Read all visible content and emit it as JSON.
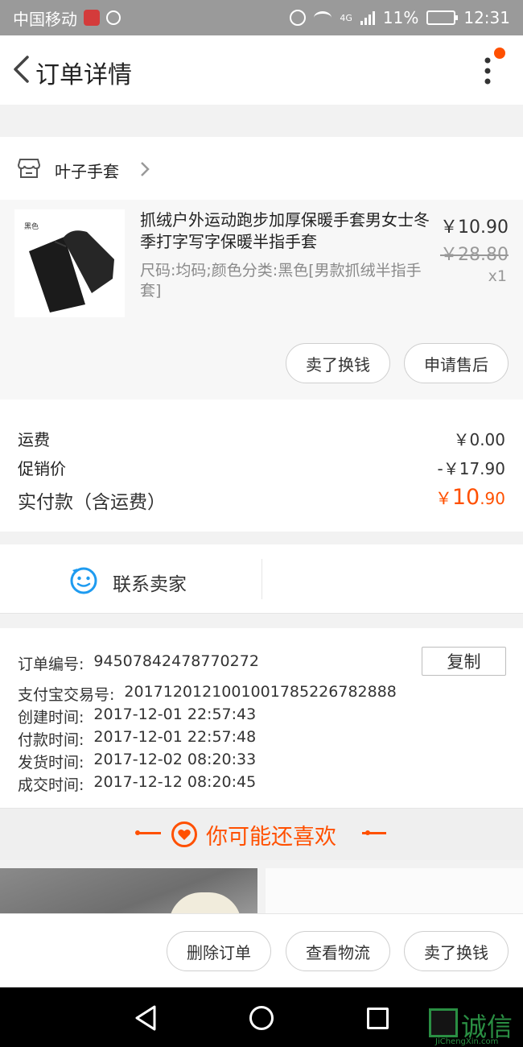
{
  "status_bar": {
    "carrier": "中国移动",
    "network": "4G",
    "battery": "11%",
    "time": "12:31",
    "icons": [
      "notification-badge-icon",
      "hand-icon",
      "alarm-icon",
      "wifi-icon",
      "signal-icon",
      "battery-icon"
    ]
  },
  "nav": {
    "title": "订单详情",
    "back_icon": "chevron-left-icon",
    "more_icon": "more-vertical-icon",
    "accent": "#ff5000"
  },
  "shop": {
    "name": "叶子手套",
    "icon": "store-icon"
  },
  "item": {
    "thumb_tag": "黑色",
    "title": "抓绒户外运动跑步加厚保暖手套男女士冬季打字写字保暖半指手套",
    "spec": "尺码:均码;颜色分类:黑色[男款抓绒半指手套]",
    "price": "￥10.90",
    "original_price": "￥28.80",
    "quantity": "x1",
    "buttons": [
      "卖了换钱",
      "申请售后"
    ]
  },
  "summary": {
    "shipping_label": "运费",
    "shipping_value": "￥0.00",
    "promo_label": "促销价",
    "promo_value": "-￥17.90",
    "paid_label": "实付款（含运费）",
    "paid_currency": "￥",
    "paid_integer": "10",
    "paid_decimal": ".90"
  },
  "contact": {
    "label": "联系卖家",
    "icon": "smile-chat-icon"
  },
  "order_info": {
    "copy_label": "复制",
    "rows": [
      {
        "label": "订单编号:",
        "value": "94507842478770272"
      },
      {
        "label": "支付宝交易号:",
        "value": "2017120121001001785226782888"
      },
      {
        "label": "创建时间:",
        "value": "2017-12-01 22:57:43"
      },
      {
        "label": "付款时间:",
        "value": "2017-12-01 22:57:48"
      },
      {
        "label": "发货时间:",
        "value": "2017-12-02 08:20:33"
      },
      {
        "label": "成交时间:",
        "value": "2017-12-12 08:20:45"
      }
    ]
  },
  "recommend": {
    "title": "你可能还喜欢",
    "icon": "heart-circle-icon"
  },
  "actions": [
    "删除订单",
    "查看物流",
    "卖了换钱"
  ],
  "watermark": {
    "text": "诚信",
    "sub": "JiChengXin.com"
  }
}
